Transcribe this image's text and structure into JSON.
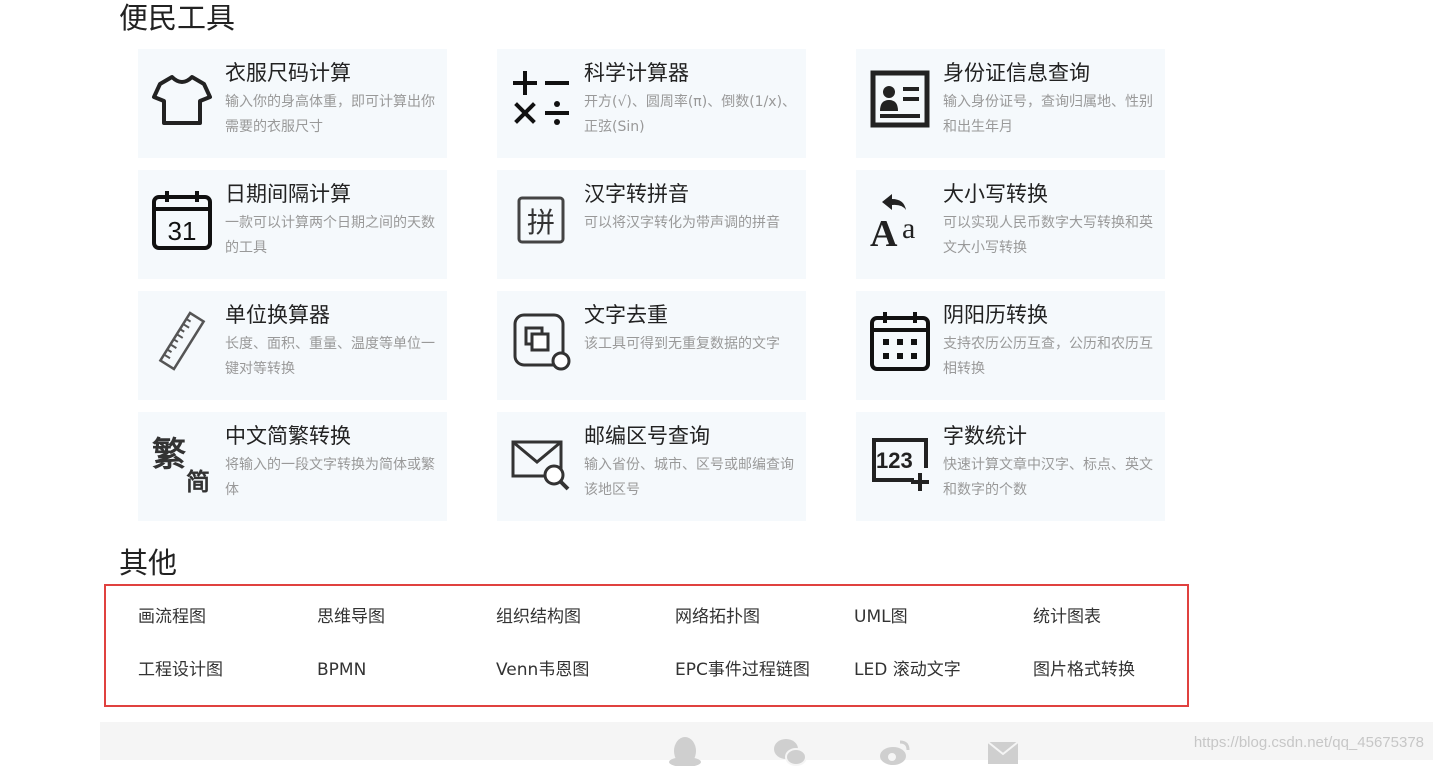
{
  "sections": {
    "tools_title": "便民工具",
    "other_title": "其他"
  },
  "tools": [
    {
      "title": "衣服尺码计算",
      "desc": "输入你的身高体重，即可计算出你需要的衣服尺寸",
      "icon": "tshirt-icon"
    },
    {
      "title": "科学计算器",
      "desc": "开方(√)、圆周率(π)、倒数(1/x)、正弦(Sin)",
      "icon": "calculator-icon"
    },
    {
      "title": "身份证信息查询",
      "desc": "输入身份证号，查询归属地、性别和出生年月",
      "icon": "id-card-icon"
    },
    {
      "title": "日期间隔计算",
      "desc": "一款可以计算两个日期之间的天数的工具",
      "icon": "calendar-31-icon"
    },
    {
      "title": "汉字转拼音",
      "desc": "可以将汉字转化为带声调的拼音",
      "icon": "pinyin-icon"
    },
    {
      "title": "大小写转换",
      "desc": "可以实现人民币数字大写转换和英文大小写转换",
      "icon": "case-convert-icon"
    },
    {
      "title": "单位换算器",
      "desc": "长度、面积、重量、温度等单位一键对等转换",
      "icon": "ruler-icon"
    },
    {
      "title": "文字去重",
      "desc": "该工具可得到无重复数据的文字",
      "icon": "dedupe-icon"
    },
    {
      "title": "阴阳历转换",
      "desc": "支持农历公历互查，公历和农历互相转换",
      "icon": "calendar-grid-icon"
    },
    {
      "title": "中文简繁转换",
      "desc": "将输入的一段文字转换为简体或繁体",
      "icon": "simp-trad-icon"
    },
    {
      "title": "邮编区号查询",
      "desc": "输入省份、城市、区号或邮编查询该地区号",
      "icon": "mail-search-icon"
    },
    {
      "title": "字数统计",
      "desc": "快速计算文章中汉字、标点、英文和数字的个数",
      "icon": "count-123-icon"
    }
  ],
  "other_links": [
    "画流程图",
    "思维导图",
    "组织结构图",
    "网络拓扑图",
    "UML图",
    "统计图表",
    "工程设计图",
    "BPMN",
    "Venn韦恩图",
    "EPC事件过程链图",
    "LED 滚动文字",
    "图片格式转换"
  ],
  "footer": {
    "icons": [
      "qq-icon",
      "wechat-icon",
      "weibo-icon",
      "mail-icon"
    ]
  },
  "watermark": "https://blog.csdn.net/qq_45675378",
  "colors": {
    "card_bg": "#f5f9fc",
    "highlight_border": "#e0413f",
    "desc_text": "#999999"
  }
}
